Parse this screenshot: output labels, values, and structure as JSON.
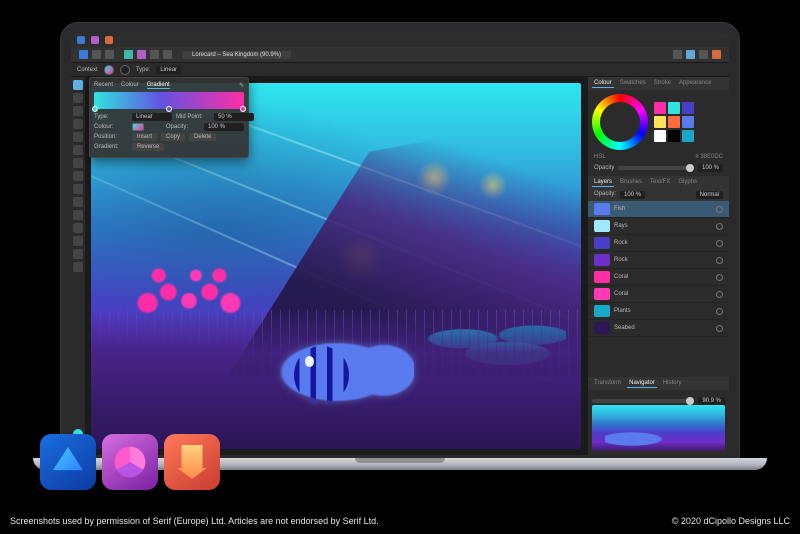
{
  "document_title": "Lorecard – Sea Kingdom (90.9%)",
  "context": {
    "label": "Context",
    "type_label": "Type:",
    "type_value": "Linear"
  },
  "gradient_panel": {
    "tabs": [
      "Recent",
      "Colour",
      "Gradient"
    ],
    "type_label": "Type:",
    "type_value": "Linear",
    "mid_point_label": "Mid Point:",
    "mid_point_value": "50 %",
    "colour_label": "Colour:",
    "opacity_label": "Opacity:",
    "opacity_value": "100 %",
    "btn_insert": "Insert",
    "btn_copy": "Copy",
    "btn_delete": "Delete",
    "btn_reverse": "Reverse",
    "position_label": "Position:"
  },
  "colour_panel": {
    "tabs": [
      "Colour",
      "Swatches",
      "Stroke",
      "Appearance"
    ],
    "mode": "HSL",
    "hex": "# 38E0DC",
    "opacity_label": "Opacity",
    "opacity_value": "100 %",
    "swatches": [
      "#ff2da6",
      "#30e3e0",
      "#4a3ec9",
      "#ffe25a",
      "#ff6a3a",
      "#5a7af0",
      "#ffffff",
      "#000000",
      "#16a9c8"
    ]
  },
  "layers_panel": {
    "tabs": [
      "Layers",
      "Brushes",
      "Text/FX",
      "Glyphs"
    ],
    "opacity_label": "Opacity:",
    "opacity_value": "100 %",
    "blend_value": "Normal",
    "items": [
      {
        "name": "Fish",
        "colour": "#5a7af0",
        "sel": true
      },
      {
        "name": "Rays",
        "colour": "#9fe8ff"
      },
      {
        "name": "Rock",
        "colour": "#4a3ec9"
      },
      {
        "name": "Rock",
        "colour": "#6e2ec9"
      },
      {
        "name": "Coral",
        "colour": "#ff2da6"
      },
      {
        "name": "Coral",
        "colour": "#ff3ab4"
      },
      {
        "name": "Plants",
        "colour": "#16a9c8"
      },
      {
        "name": "Seabed",
        "colour": "#2c1657"
      }
    ]
  },
  "nav_panel": {
    "tabs": [
      "Transform",
      "Navigator",
      "History"
    ],
    "zoom_value": "90.9 %"
  },
  "captions": {
    "left": "Screenshots used by permission of Serif (Europe) Ltd. Articles are not endorsed by Serif Ltd.",
    "right": "© 2020 dCipollo Designs LLC"
  }
}
